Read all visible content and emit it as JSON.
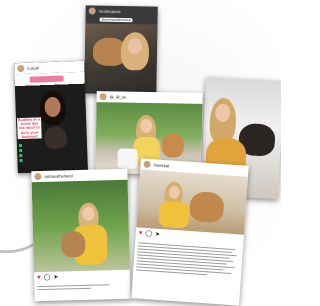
{
  "cards": {
    "story_top": {
      "username": "nicolecaputo",
      "tag": "stevenandchrisreal"
    },
    "story_left": {
      "username": "s.studi",
      "pill": "",
      "text": "Buddies on a sunny day\nnot much to do in your\nbackyard"
    },
    "post_center": {
      "username": "@_lili_ok"
    },
    "post_right_story": {
      "username": ""
    },
    "post_bottom_left": {
      "username": "aishasutherland"
    },
    "post_bottom_right": {
      "username": "bauerkat"
    }
  },
  "colors": {
    "shadow": "#777777",
    "story_text": "#e6324b",
    "like": "#e0245e"
  },
  "icons": [
    "heart-icon",
    "comment-icon",
    "share-icon",
    "bookmark-icon"
  ]
}
